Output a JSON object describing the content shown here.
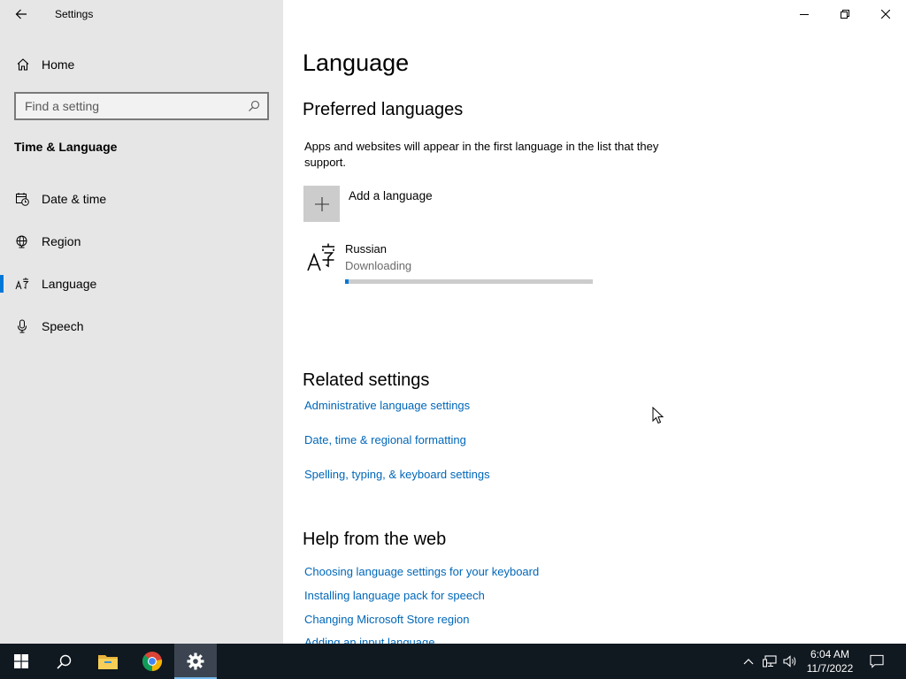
{
  "window": {
    "title": "Settings"
  },
  "sidebar": {
    "home_label": "Home",
    "search_placeholder": "Find a setting",
    "section_title": "Time & Language",
    "items": [
      {
        "label": "Date & time",
        "icon": "calendar-clock-icon"
      },
      {
        "label": "Region",
        "icon": "globe-icon"
      },
      {
        "label": "Language",
        "icon": "language-icon",
        "active": true
      },
      {
        "label": "Speech",
        "icon": "microphone-icon"
      }
    ]
  },
  "main": {
    "title": "Language",
    "preferred": {
      "heading": "Preferred languages",
      "description": "Apps and websites will appear in the first language in the list that they support.",
      "add_label": "Add a language",
      "languages": [
        {
          "name": "Russian",
          "status": "Downloading",
          "progress": 0.015
        }
      ]
    },
    "related": {
      "heading": "Related settings",
      "links": [
        "Administrative language settings",
        "Date, time & regional formatting",
        "Spelling, typing, & keyboard settings"
      ]
    },
    "help": {
      "heading": "Help from the web",
      "links": [
        "Choosing language settings for your keyboard",
        "Installing language pack for speech",
        "Changing Microsoft Store region",
        "Adding an input language"
      ]
    }
  },
  "taskbar": {
    "time": "6:04 AM",
    "date": "11/7/2022"
  },
  "colors": {
    "accent": "#0078d7",
    "link": "#0067b8",
    "sidebar_bg": "#e6e6e6",
    "taskbar_bg": "#101820"
  }
}
